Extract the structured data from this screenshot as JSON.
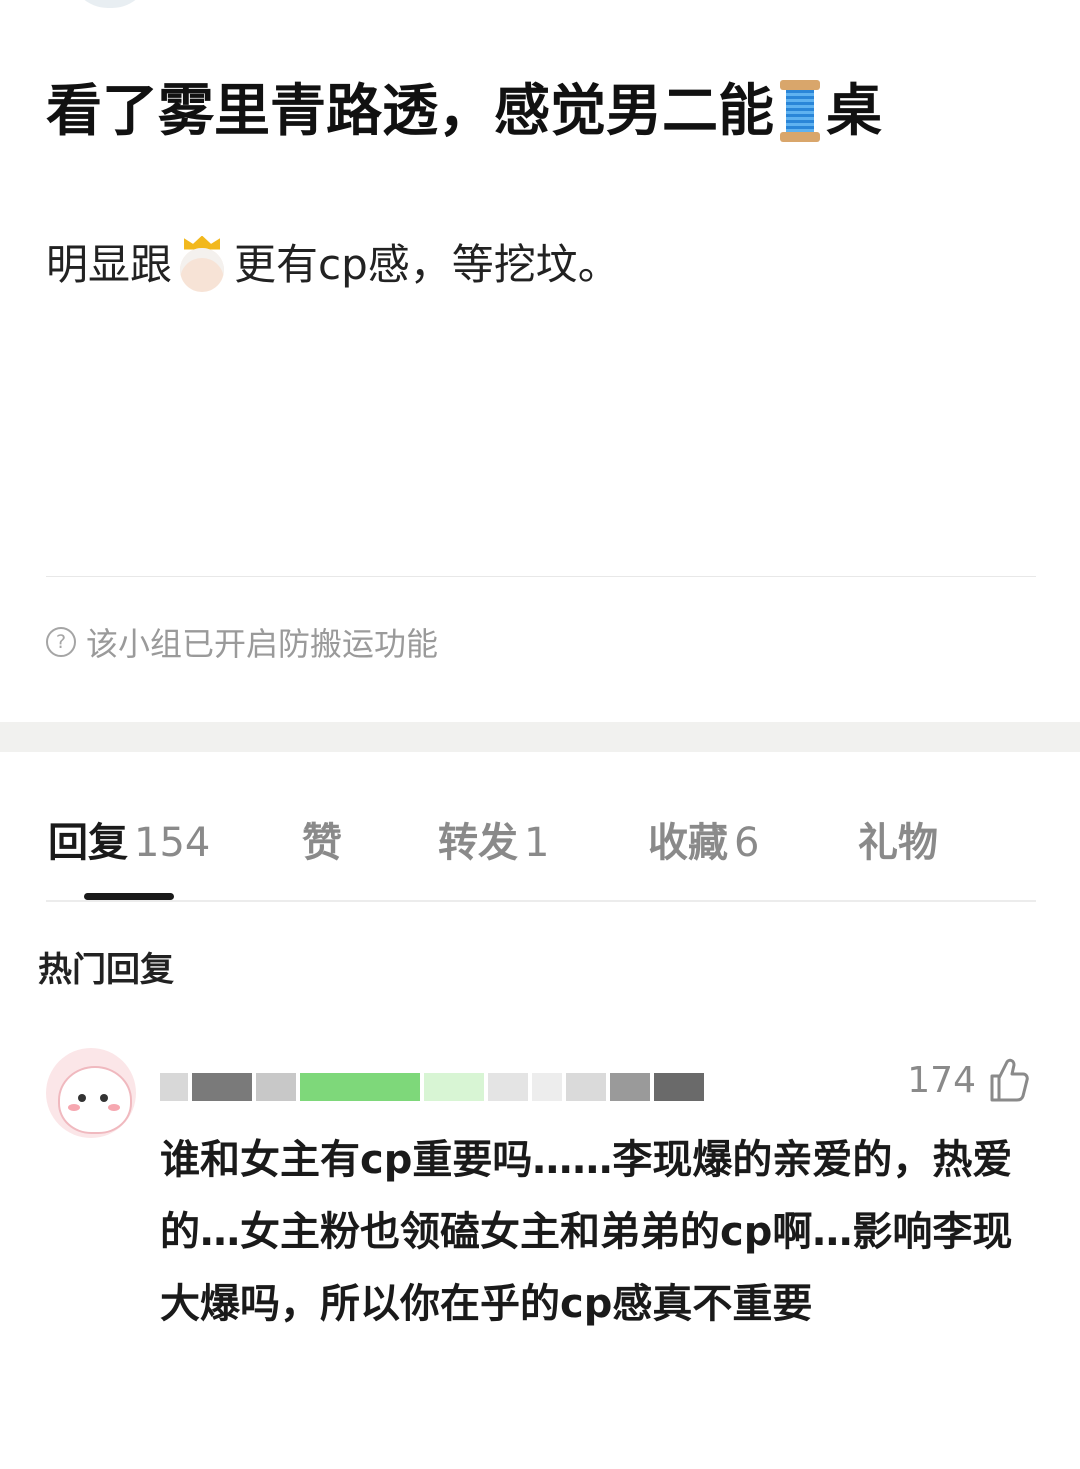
{
  "post": {
    "title": "看了雾里青路透，感觉男二能",
    "title_emoji_name": "spool-of-thread-emoji",
    "title_suffix": "桌",
    "body_prefix": "明显跟",
    "body_emoji_name": "princess-emoji",
    "body_suffix": "更有cp感，等挖坟。",
    "notice": "该小组已开启防搬运功能"
  },
  "tabs": [
    {
      "label": "回复",
      "count": "154",
      "active": true
    },
    {
      "label": "赞",
      "count": ""
    },
    {
      "label": "转发",
      "count": "1"
    },
    {
      "label": "收藏",
      "count": "6"
    },
    {
      "label": "礼物",
      "count": ""
    }
  ],
  "section_title": "热门回复",
  "comment": {
    "likes": "174",
    "text": "谁和女主有cp重要吗……李现爆的亲爱的，热爱的…女主粉也领磕女主和弟弟的cp啊…影响李现大爆吗，所以你在乎的cp感真不重要"
  },
  "colors": {
    "text_primary": "#1a1a1a",
    "text_muted": "#8a8a8a",
    "separator_band": "#f1f1ef",
    "username_green": "#7ed87a"
  }
}
